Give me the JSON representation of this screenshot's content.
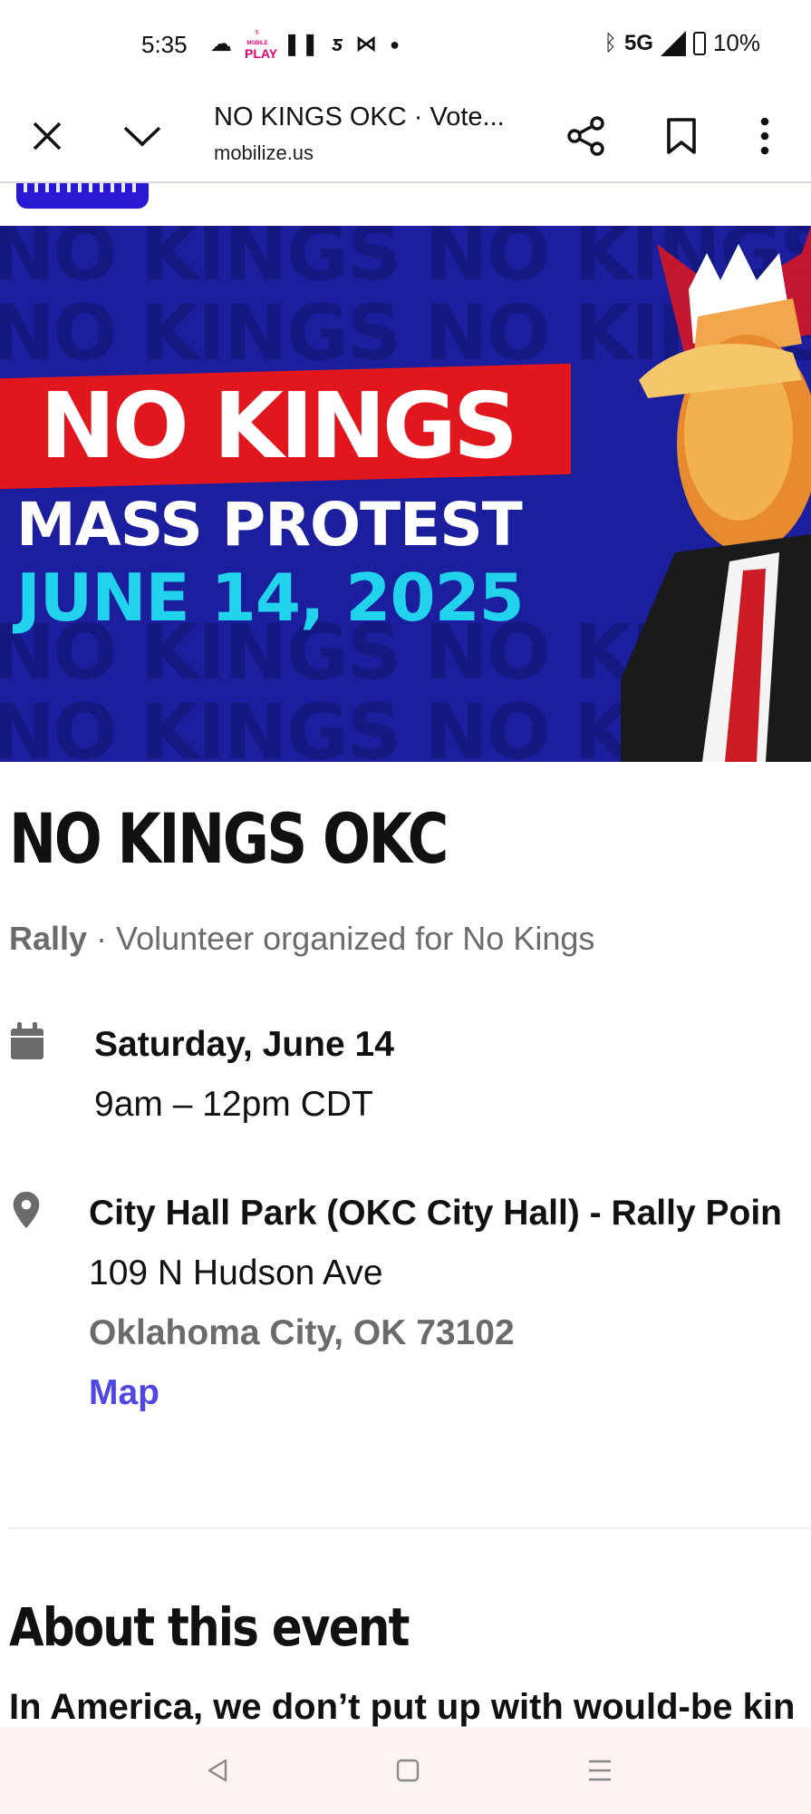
{
  "status_bar": {
    "time": "5:35",
    "tmobile_label_1": "T-MOBILE",
    "tmobile_label_2": "PLAY",
    "network": "5G",
    "battery": "10%"
  },
  "toolbar": {
    "page_title": "NO KINGS OKC · Vote...",
    "domain": "mobilize.us",
    "icons": [
      "close-icon",
      "chevron-down-icon",
      "share-icon",
      "bookmark-icon",
      "more-vert-icon"
    ]
  },
  "hero": {
    "bg_text": "NO KINGS",
    "line1": "NO KINGS",
    "line2": "MASS PROTEST",
    "line3": "JUNE 14, 2025",
    "colors": {
      "background": "#1b1f9e",
      "accent_red": "#e1171d",
      "accent_cyan": "#22d3ee"
    }
  },
  "event": {
    "title": "NO KINGS OKC",
    "type": "Rally",
    "organizer": " · Volunteer organized for No Kings",
    "date": "Saturday, June 14",
    "time": "9am – 12pm CDT",
    "location_name": "City Hall Park (OKC City Hall) - Rally Poin",
    "address": "109 N Hudson Ave",
    "city_state_zip": "Oklahoma City, OK 73102",
    "map_label": "Map",
    "link_color": "#4f46e5"
  },
  "about": {
    "heading": "About this event",
    "text": "In America, we don’t put up with would-be kin"
  }
}
